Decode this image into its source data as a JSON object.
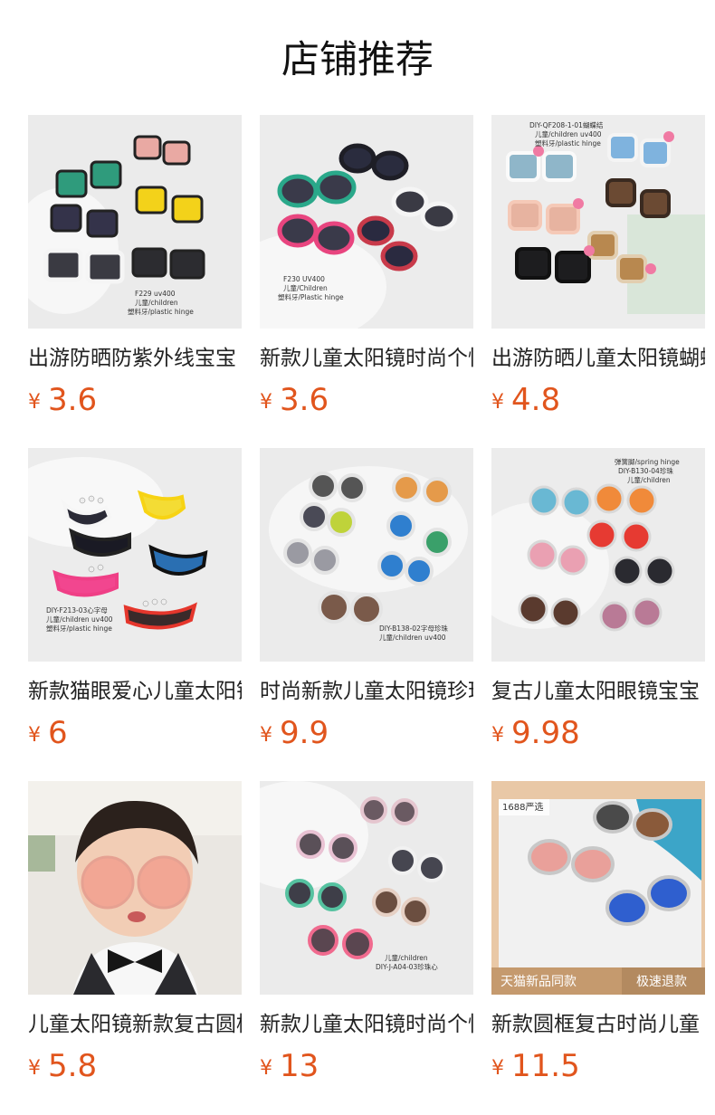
{
  "section_title": "店铺推荐",
  "products": [
    {
      "title": "出游防晒防紫外线宝宝",
      "currency": "¥",
      "price": "3.6",
      "image": {
        "labels": [
          "F229  uv400",
          "儿童/children",
          "塑料牙/plastic hinge"
        ]
      }
    },
    {
      "title": "新款儿童太阳镜时尚个性",
      "currency": "¥",
      "price": "3.6",
      "image": {
        "labels": [
          "F230 UV400",
          "儿童/Children",
          "塑料牙/Plastic hinge"
        ]
      }
    },
    {
      "title": "出游防晒儿童太阳镜蝴蝶",
      "currency": "¥",
      "price": "4.8",
      "image": {
        "labels": [
          "DIY-QF208-1-01蝴蝶结",
          "儿童/children uv400",
          "塑料牙/plastic  hinge"
        ]
      }
    },
    {
      "title": "新款猫眼爱心儿童太阳镜",
      "currency": "¥",
      "price": "6",
      "image": {
        "labels": [
          "DIY-F213-03心字母",
          "儿童/children uv400",
          "塑料牙/plastic hinge"
        ]
      }
    },
    {
      "title": "时尚新款儿童太阳镜珍珠",
      "currency": "¥",
      "price": "9.9",
      "image": {
        "labels": [
          "DIY-B138-02字母珍珠",
          "儿童/children uv400"
        ]
      }
    },
    {
      "title": "复古儿童太阳眼镜宝宝",
      "currency": "¥",
      "price": "9.98",
      "image": {
        "labels": [
          "弹簧脚/spring hinge",
          "DIY-B130-04珍珠",
          "儿童/children"
        ]
      }
    },
    {
      "title": "儿童太阳镜新款复古圆框",
      "currency": "¥",
      "price": "5.8",
      "image": {
        "labels": []
      }
    },
    {
      "title": "新款儿童太阳镜时尚个性",
      "currency": "¥",
      "price": "13",
      "image": {
        "labels": [
          "儿童/children",
          "DIY-J-A04-03珍珠心"
        ]
      }
    },
    {
      "title": "新款圆框复古时尚儿童",
      "currency": "¥",
      "price": "11.5",
      "image": {
        "labels": [
          "1688严选",
          "天猫新品同款",
          "极速退款"
        ]
      }
    }
  ],
  "colors": {
    "price": "#e1551d",
    "title": "#222222",
    "heading": "#111111"
  }
}
